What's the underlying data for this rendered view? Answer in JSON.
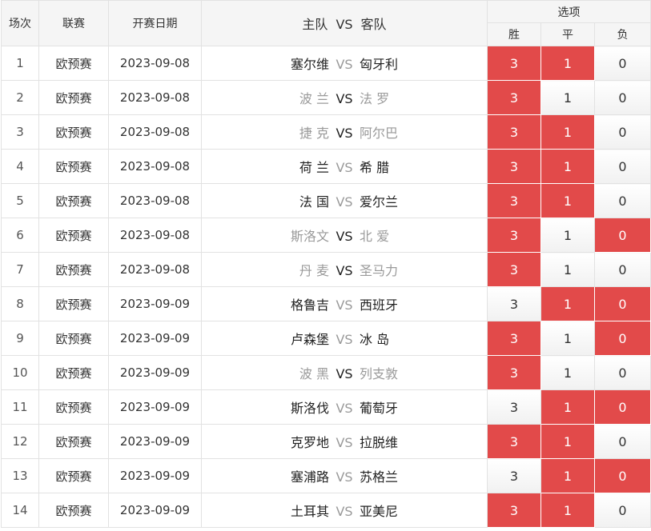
{
  "header": {
    "col_index": "场次",
    "col_league": "联赛",
    "col_date": "开赛日期",
    "col_home": "主队",
    "col_vs": "VS",
    "col_away": "客队",
    "col_options": "选项",
    "opt_win": "胜",
    "opt_draw": "平",
    "opt_lose": "负"
  },
  "colors": {
    "selected": "#e24a4a",
    "vs_active": "#222222",
    "vs_dim": "#9a9a9a"
  },
  "matches": [
    {
      "no": "1",
      "league": "欧预赛",
      "date": "2023-09-08",
      "home": "塞尔维",
      "away": "匈牙利",
      "vs": "VS",
      "win": "3",
      "draw": "1",
      "lose": "0",
      "win_sel": true,
      "draw_sel": true,
      "lose_sel": false,
      "home_dim": false,
      "away_dim": false,
      "vs_dim": true
    },
    {
      "no": "2",
      "league": "欧预赛",
      "date": "2023-09-08",
      "home": "波 兰",
      "away": "法 罗",
      "vs": "VS",
      "win": "3",
      "draw": "1",
      "lose": "0",
      "win_sel": true,
      "draw_sel": false,
      "lose_sel": false,
      "home_dim": true,
      "away_dim": true,
      "vs_dim": false
    },
    {
      "no": "3",
      "league": "欧预赛",
      "date": "2023-09-08",
      "home": "捷 克",
      "away": "阿尔巴",
      "vs": "VS",
      "win": "3",
      "draw": "1",
      "lose": "0",
      "win_sel": true,
      "draw_sel": true,
      "lose_sel": false,
      "home_dim": true,
      "away_dim": true,
      "vs_dim": false
    },
    {
      "no": "4",
      "league": "欧预赛",
      "date": "2023-09-08",
      "home": "荷 兰",
      "away": "希 腊",
      "vs": "VS",
      "win": "3",
      "draw": "1",
      "lose": "0",
      "win_sel": true,
      "draw_sel": true,
      "lose_sel": false,
      "home_dim": false,
      "away_dim": false,
      "vs_dim": true
    },
    {
      "no": "5",
      "league": "欧预赛",
      "date": "2023-09-08",
      "home": "法 国",
      "away": "爱尔兰",
      "vs": "VS",
      "win": "3",
      "draw": "1",
      "lose": "0",
      "win_sel": true,
      "draw_sel": true,
      "lose_sel": false,
      "home_dim": false,
      "away_dim": false,
      "vs_dim": true
    },
    {
      "no": "6",
      "league": "欧预赛",
      "date": "2023-09-08",
      "home": "斯洛文",
      "away": "北 爱",
      "vs": "VS",
      "win": "3",
      "draw": "1",
      "lose": "0",
      "win_sel": true,
      "draw_sel": false,
      "lose_sel": true,
      "home_dim": true,
      "away_dim": true,
      "vs_dim": false
    },
    {
      "no": "7",
      "league": "欧预赛",
      "date": "2023-09-08",
      "home": "丹 麦",
      "away": "圣马力",
      "vs": "VS",
      "win": "3",
      "draw": "1",
      "lose": "0",
      "win_sel": true,
      "draw_sel": false,
      "lose_sel": false,
      "home_dim": true,
      "away_dim": true,
      "vs_dim": false
    },
    {
      "no": "8",
      "league": "欧预赛",
      "date": "2023-09-09",
      "home": "格鲁吉",
      "away": "西班牙",
      "vs": "VS",
      "win": "3",
      "draw": "1",
      "lose": "0",
      "win_sel": false,
      "draw_sel": true,
      "lose_sel": true,
      "home_dim": false,
      "away_dim": false,
      "vs_dim": true
    },
    {
      "no": "9",
      "league": "欧预赛",
      "date": "2023-09-09",
      "home": "卢森堡",
      "away": "冰 岛",
      "vs": "VS",
      "win": "3",
      "draw": "1",
      "lose": "0",
      "win_sel": true,
      "draw_sel": false,
      "lose_sel": true,
      "home_dim": false,
      "away_dim": false,
      "vs_dim": true
    },
    {
      "no": "10",
      "league": "欧预赛",
      "date": "2023-09-09",
      "home": "波 黑",
      "away": "列支敦",
      "vs": "VS",
      "win": "3",
      "draw": "1",
      "lose": "0",
      "win_sel": true,
      "draw_sel": false,
      "lose_sel": false,
      "home_dim": true,
      "away_dim": true,
      "vs_dim": false
    },
    {
      "no": "11",
      "league": "欧预赛",
      "date": "2023-09-09",
      "home": "斯洛伐",
      "away": "葡萄牙",
      "vs": "VS",
      "win": "3",
      "draw": "1",
      "lose": "0",
      "win_sel": false,
      "draw_sel": true,
      "lose_sel": true,
      "home_dim": false,
      "away_dim": false,
      "vs_dim": true
    },
    {
      "no": "12",
      "league": "欧预赛",
      "date": "2023-09-09",
      "home": "克罗地",
      "away": "拉脱维",
      "vs": "VS",
      "win": "3",
      "draw": "1",
      "lose": "0",
      "win_sel": true,
      "draw_sel": true,
      "lose_sel": false,
      "home_dim": false,
      "away_dim": false,
      "vs_dim": true
    },
    {
      "no": "13",
      "league": "欧预赛",
      "date": "2023-09-09",
      "home": "塞浦路",
      "away": "苏格兰",
      "vs": "VS",
      "win": "3",
      "draw": "1",
      "lose": "0",
      "win_sel": false,
      "draw_sel": true,
      "lose_sel": true,
      "home_dim": false,
      "away_dim": false,
      "vs_dim": true
    },
    {
      "no": "14",
      "league": "欧预赛",
      "date": "2023-09-09",
      "home": "土耳其",
      "away": "亚美尼",
      "vs": "VS",
      "win": "3",
      "draw": "1",
      "lose": "0",
      "win_sel": true,
      "draw_sel": true,
      "lose_sel": false,
      "home_dim": false,
      "away_dim": false,
      "vs_dim": true
    }
  ]
}
